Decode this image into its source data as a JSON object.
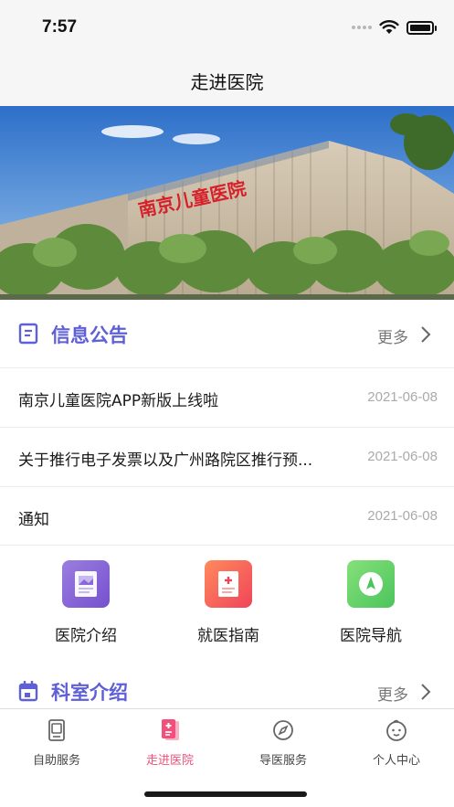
{
  "status_bar": {
    "time": "7:57"
  },
  "nav": {
    "title": "走进医院"
  },
  "banner": {
    "sign_text": "南京儿童医院"
  },
  "notices": {
    "title": "信息公告",
    "more": "更多",
    "items": [
      {
        "text": "南京儿童医院APP新版上线啦",
        "date": "2021-06-08"
      },
      {
        "text": "关于推行电子发票以及广州路院区推行预...",
        "date": "2021-06-08"
      },
      {
        "text": "通知",
        "date": "2021-06-08"
      }
    ]
  },
  "features": [
    {
      "label": "医院介绍",
      "icon": "document-image-icon"
    },
    {
      "label": "就医指南",
      "icon": "medical-record-icon"
    },
    {
      "label": "医院导航",
      "icon": "navigation-compass-icon"
    }
  ],
  "departments": {
    "title": "科室介绍",
    "more": "更多"
  },
  "tabs": [
    {
      "label": "自助服务",
      "icon": "self-service-icon",
      "active": false
    },
    {
      "label": "走进医院",
      "icon": "hospital-icon",
      "active": true
    },
    {
      "label": "导医服务",
      "icon": "compass-icon",
      "active": false
    },
    {
      "label": "个人中心",
      "icon": "baby-face-icon",
      "active": false
    }
  ],
  "colors": {
    "accent": "#5f5fd6",
    "tab_active": "#f0507a",
    "tile_purple": "#8a62d8",
    "tile_red": "#f25560",
    "tile_green": "#6ad06a"
  }
}
